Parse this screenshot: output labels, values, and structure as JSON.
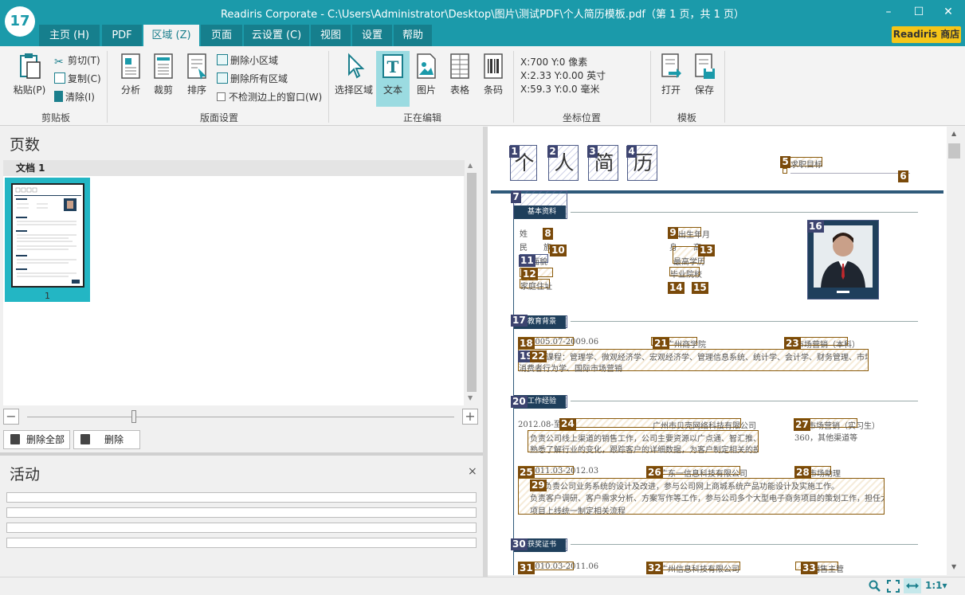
{
  "window": {
    "app_badge": "17",
    "title": "Readiris Corporate - C:\\Users\\Administrator\\Desktop\\图片\\测试PDF\\个人简历模板.pdf（第 1 页，共 1 页）",
    "store_label": "Readiris 商店",
    "min": "–",
    "max": "☐",
    "close": "✕"
  },
  "tabs": [
    {
      "label": "主页 (H)"
    },
    {
      "label": "PDF"
    },
    {
      "label": "区域 (Z)"
    },
    {
      "label": "页面"
    },
    {
      "label": "云设置 (C)"
    },
    {
      "label": "视图"
    },
    {
      "label": "设置"
    },
    {
      "label": "帮助"
    }
  ],
  "ribbon": {
    "clipboard": {
      "group": "剪贴板",
      "paste": "粘贴(P)",
      "cut": "剪切(T)",
      "copy": "复制(C)",
      "clear": "清除(I)"
    },
    "layout": {
      "group": "版面设置",
      "analyze": "分析",
      "crop": "裁剪",
      "sort": "排序",
      "delete_small": "删除小区域",
      "delete_all": "删除所有区域",
      "ignore_edge": "不检测边上的窗口(W)"
    },
    "editing": {
      "group": "正在编辑",
      "select": "选择区域",
      "text": "文本",
      "image": "图片",
      "table": "表格",
      "barcode": "条码"
    },
    "coords": {
      "group": "坐标位置",
      "px": "X:700  Y:0 像素",
      "inch": "X:2.33  Y:0.00 英寸",
      "mm": "X:59.3  Y:0.0 毫米"
    },
    "template": {
      "group": "模板",
      "open": "打开",
      "save": "保存"
    }
  },
  "left": {
    "pages_title": "页数",
    "doc_label": "文档 1",
    "thumb_number": "1",
    "zoom_minus": "−",
    "zoom_plus": "+",
    "delete_all": "删除全部",
    "delete": "删除",
    "activity_title": "活动",
    "activity_close": "×",
    "zoom_level": 0.25
  },
  "document": {
    "heading_chars": [
      "个",
      "人",
      "简",
      "历"
    ],
    "zones": [
      {
        "n": "1",
        "blue": true
      },
      {
        "n": "2",
        "blue": true
      },
      {
        "n": "3",
        "blue": true
      },
      {
        "n": "4",
        "blue": true
      },
      {
        "n": "5"
      },
      {
        "n": "6"
      },
      {
        "n": "7",
        "blue": true
      },
      {
        "n": "8"
      },
      {
        "n": "9"
      },
      {
        "n": "10"
      },
      {
        "n": "11",
        "blue": true
      },
      {
        "n": "12"
      },
      {
        "n": "13"
      },
      {
        "n": "14"
      },
      {
        "n": "15"
      },
      {
        "n": "16",
        "blue": true
      },
      {
        "n": "17",
        "blue": true
      },
      {
        "n": "18"
      },
      {
        "n": "19",
        "blue": true
      },
      {
        "n": "20",
        "blue": true
      },
      {
        "n": "21"
      },
      {
        "n": "22"
      },
      {
        "n": "23"
      },
      {
        "n": "24"
      },
      {
        "n": "25"
      },
      {
        "n": "26"
      },
      {
        "n": "27"
      },
      {
        "n": "28"
      },
      {
        "n": "29"
      },
      {
        "n": "30",
        "blue": true
      },
      {
        "n": "31"
      },
      {
        "n": "32"
      },
      {
        "n": "33"
      }
    ],
    "texts": {
      "job": "求职目标",
      "sec1": "基本资料",
      "xing": "姓",
      "min": "民",
      "zu": "族",
      "csny": "出生年月",
      "shen": "身",
      "gao": "高",
      "ms": "面貌",
      "zgyx": "最高学历",
      "byyx": "毕业院校",
      "jtdz": "家庭住址",
      "sec2": "教育背景",
      "edu_date": "2005.07-2009.06",
      "edu_school": "广州商学院",
      "edu_major": "市场营销（本科）",
      "edu_courses": "主修课程：管理学、微观经济学、宏观经济学、管理信息系统、统计学、会计学、财务管理、市场营销、经济法、",
      "edu_courses2": "消费者行为学、国际市场营销",
      "sec3": "工作经验",
      "w1_date": "2012.08-至今",
      "w1_company": "广州市贝壳网络科技有限公司",
      "w1_title": "市场营销（实习生）",
      "w1_l1": "负责公司线上渠道的销售工作，公司主要资源以广点通、智汇推、百度",
      "w1_l2": "熟悉了解行业的变化，跟踪客户的详细数据，为客户制定相关的投放计划",
      "w1_l3": "360，其他渠道等",
      "w2_date": "2011.03-2012.03",
      "w2_company": "广东一信息科技有限公司",
      "w2_title": "市场助理",
      "w2_l1": "负责公司业务系统的设计及改进，参与公司网上商城系统产品功能设计及实施工作。",
      "w2_l2": "负责客户调研、客户需求分析、方案写作等工作，参与公司多个大型电子商务项目的策划工作，担任大商城",
      "w2_l3": "项目上线统一制定相关流程",
      "sec4": "获奖证书",
      "w3_date": "2010.03-2011.06",
      "w3_company": "广州信息科技有限公司",
      "w3_title": "销售主管"
    }
  },
  "status": {
    "zoom_label": "1:1",
    "dropdown": "▾"
  }
}
